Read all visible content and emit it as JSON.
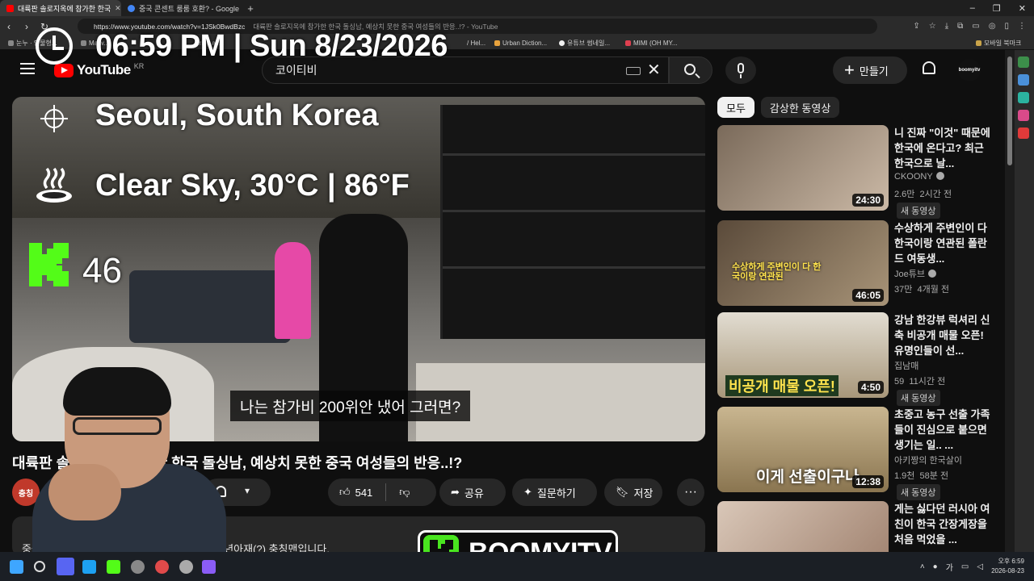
{
  "browser": {
    "tabs": [
      {
        "label": "대륙판 솔로지옥에 참가한 한국",
        "favicon_color": "#ff0000",
        "active": true
      },
      {
        "label": "중국 콘센트 룸룸 호환? - Google",
        "favicon_color": "#4285f4",
        "active": false
      }
    ],
    "new_tab_label": "+",
    "window_controls": [
      "–",
      "❐",
      "✕"
    ],
    "url": "https://www.youtube.com/watch?v=1JSk0BwdBzc",
    "page_title": "대륙판 솔로지옥에 참가한 한국 돌싱남, 예상치 못한 중국 여성들의 반응..!? - YouTube",
    "bookmarks": [
      {
        "label": "눈누 · 인물형..."
      },
      {
        "label": "Malw..."
      },
      {
        "label": "...ring ac..."
      },
      {
        "label": "/ Hel..."
      },
      {
        "label": "Urban Diction..."
      },
      {
        "label": "유튜브 썸네일..."
      },
      {
        "label": "MIMI (OH MY..."
      },
      {
        "label": "모바일 북마크"
      }
    ]
  },
  "youtube": {
    "logo_text": "YouTube",
    "region": "KR",
    "search_query": "코이티비",
    "create_label": "만들기",
    "avatar_text": "boomyitv"
  },
  "overlay": {
    "datetime": "06:59 PM | Sun 8/23/2026",
    "location": "Seoul, South Korea",
    "weather": "Clear Sky, 30°C | 86°F",
    "count": "46"
  },
  "player": {
    "subtitle": "나는 참가비 200위안 냈어 그러면?"
  },
  "video": {
    "title": "대륙판 솔로지옥에 참가한 한국 돌싱남, 예상치 못한 중국 여성들의 반응..!?",
    "channel_avatar_text": "충칭",
    "likes": "541",
    "share_label": "공유",
    "ask_label": "질문하기",
    "save_label": "저장",
    "more_label": "···",
    "description_line": "중국 충칭(重庆)에서 19년째 살고 있는 한국 청년아재(?) 충칭맨입니다."
  },
  "brand": {
    "logo_text": "BOOMYITV",
    "accent": "#49e51f"
  },
  "chips": [
    {
      "label": "모두",
      "active": true
    },
    {
      "label": "감상한 동영상",
      "active": false
    }
  ],
  "recommendations": [
    {
      "title": "니 진짜 \"이것\" 때문에 한국에 온다고? 최근 한국으로 날...",
      "channel": "CKOONY",
      "verified": true,
      "views": "2.6만",
      "age": "2시간 전",
      "badge": "새 동영상",
      "duration": "24:30",
      "thumb_text": "",
      "thumb_color": "#8a8070"
    },
    {
      "title": "수상하게 주변인이 다 한국이랑 연관된 폴란드 여동생...",
      "channel": "Joe튜브",
      "verified": true,
      "views": "37만",
      "age": "4개월 전",
      "badge": "",
      "duration": "46:05",
      "thumb_text": "수상하게 주변인이 다 한국이랑 연관된",
      "thumb_color": "#6b5a4a"
    },
    {
      "title": "강남 한강뷰 럭셔리 신축 비공개 매물 오픈! 유명인들이 선...",
      "channel": "집남매",
      "verified": false,
      "views": "59",
      "age": "11시간 전",
      "badge": "새 동영상",
      "duration": "4:50",
      "thumb_text": "비공개 매물 오픈!",
      "thumb_color": "#b8a98c"
    },
    {
      "title": "초중고 농구 선출 가족들이 진심으로 붙으면 생기는 일.. ...",
      "channel": "아키짱의 한국살이",
      "verified": false,
      "views": "1.9천",
      "age": "58분 전",
      "badge": "새 동영상",
      "duration": "12:38",
      "thumb_text": "이게 선출이구나",
      "thumb_color": "#9b8660"
    },
    {
      "title": "게는 싫다던 러시아 여친이 한국 간장게장을 처음 먹었을 ...",
      "channel": "",
      "verified": false,
      "views": "",
      "age": "",
      "badge": "",
      "duration": "",
      "thumb_text": "",
      "thumb_color": "#c9b7a8"
    }
  ],
  "taskbar": {
    "time": "오후 6:59",
    "date": "2026-08-23",
    "lang": "가"
  }
}
